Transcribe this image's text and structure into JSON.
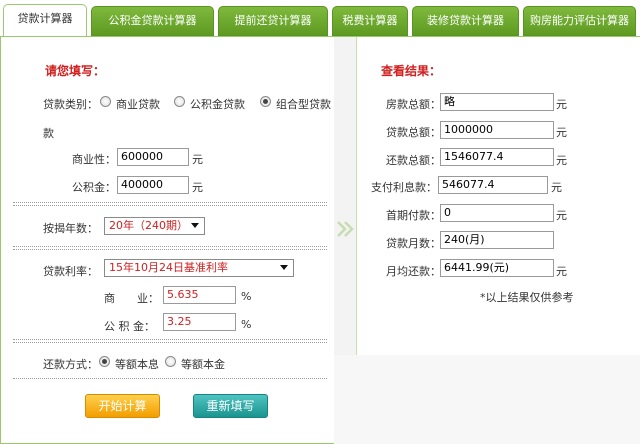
{
  "tabs": [
    {
      "label": "贷款计算器",
      "active": true
    },
    {
      "label": "公积金贷款计算器",
      "active": false
    },
    {
      "label": "提前还贷计算器",
      "active": false
    },
    {
      "label": "税费计算器",
      "active": false
    },
    {
      "label": "装修贷款计算器",
      "active": false
    },
    {
      "label": "购房能力评估计算器",
      "active": false
    }
  ],
  "left": {
    "title": "请您填写：",
    "loan_type_label": "贷款类别：",
    "loan_type_options": [
      "商业贷款",
      "公积金贷款",
      "组合型贷款"
    ],
    "loan_type_wrap": "款",
    "loan_type_selected": "组合型贷款",
    "commercial_label": "商业性：",
    "commercial_value": "600000",
    "commercial_unit": "元",
    "fund_label": "公积金：",
    "fund_value": "400000",
    "fund_unit": "元",
    "years_label": "按揭年数：",
    "years_value": "20年（240期）",
    "rate_label": "贷款利率：",
    "rate_value": "15年10月24日基准利率",
    "rate_commercial_label": "商　　业：",
    "rate_commercial_value": "5.635",
    "rate_fund_label": "公 积 金：",
    "rate_fund_value": "3.25",
    "percent": "%",
    "repay_label": "还款方式：",
    "repay_options": [
      "等额本息",
      "等额本金"
    ],
    "repay_selected": "等额本息",
    "btn_calc": "开始计算",
    "btn_reset": "重新填写"
  },
  "right": {
    "title": "查看结果：",
    "house_total_label": "房款总额：",
    "house_total_value": "略",
    "loan_total_label": "贷款总额：",
    "loan_total_value": "1000000",
    "repay_total_label": "还款总额：",
    "repay_total_value": "1546077.4",
    "interest_label": "支付利息款：",
    "interest_value": "546077.4",
    "down_label": "首期付款：",
    "down_value": "0",
    "months_label": "贷款月数：",
    "months_value": "240(月)",
    "monthly_label": "月均还款：",
    "monthly_value": "6441.99(元)",
    "unit": "元",
    "note": "*以上结果仅供参考"
  },
  "colors": {
    "accent_green": "#6aa82c",
    "label_red": "#d02020",
    "btn_orange": "#f29e00",
    "btn_teal": "#1b9490"
  }
}
